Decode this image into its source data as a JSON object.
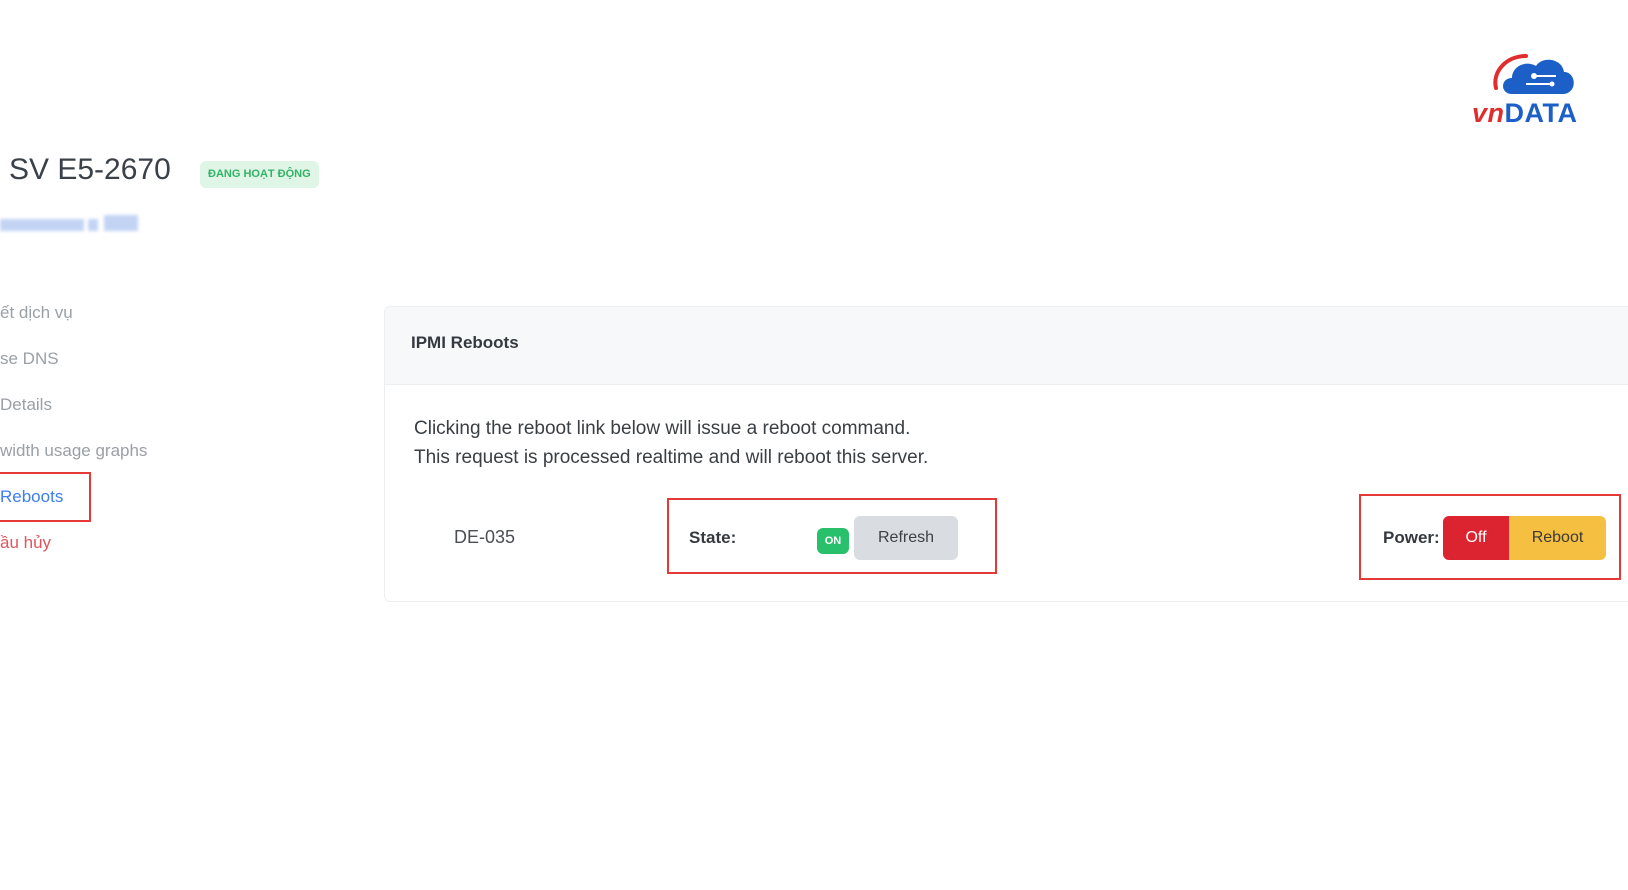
{
  "brand": {
    "logo_prefix": "vn",
    "logo_suffix": "DATA",
    "colors": {
      "red": "#e02e2e",
      "blue": "#1c60c7"
    }
  },
  "header": {
    "title": "SV E5-2670",
    "status": "ĐANG HOẠT ĐỘNG"
  },
  "sidebar": {
    "items": [
      {
        "label": "ết dịch vụ",
        "state": "default"
      },
      {
        "label": "se DNS",
        "state": "default"
      },
      {
        "label": "Details",
        "state": "default"
      },
      {
        "label": "width usage graphs",
        "state": "default"
      },
      {
        "label": "Reboots",
        "state": "active"
      },
      {
        "label": "ầu hủy",
        "state": "danger"
      }
    ]
  },
  "card": {
    "title": "IPMI Reboots",
    "description_line1": "Clicking the reboot link below will issue a reboot command.",
    "description_line2": "This request is processed realtime and will reboot this server.",
    "server_name": "DE-035",
    "state_label": "State:",
    "state_value": "ON",
    "refresh_label": "Refresh",
    "power_label": "Power:",
    "off_label": "Off",
    "reboot_label": "Reboot"
  },
  "colors": {
    "active": "#3d7ef0",
    "danger": "#e0545f",
    "on": "#28c06a",
    "off_button": "#dc2430",
    "reboot_button": "#f5bf42",
    "highlight": "#e53935"
  }
}
